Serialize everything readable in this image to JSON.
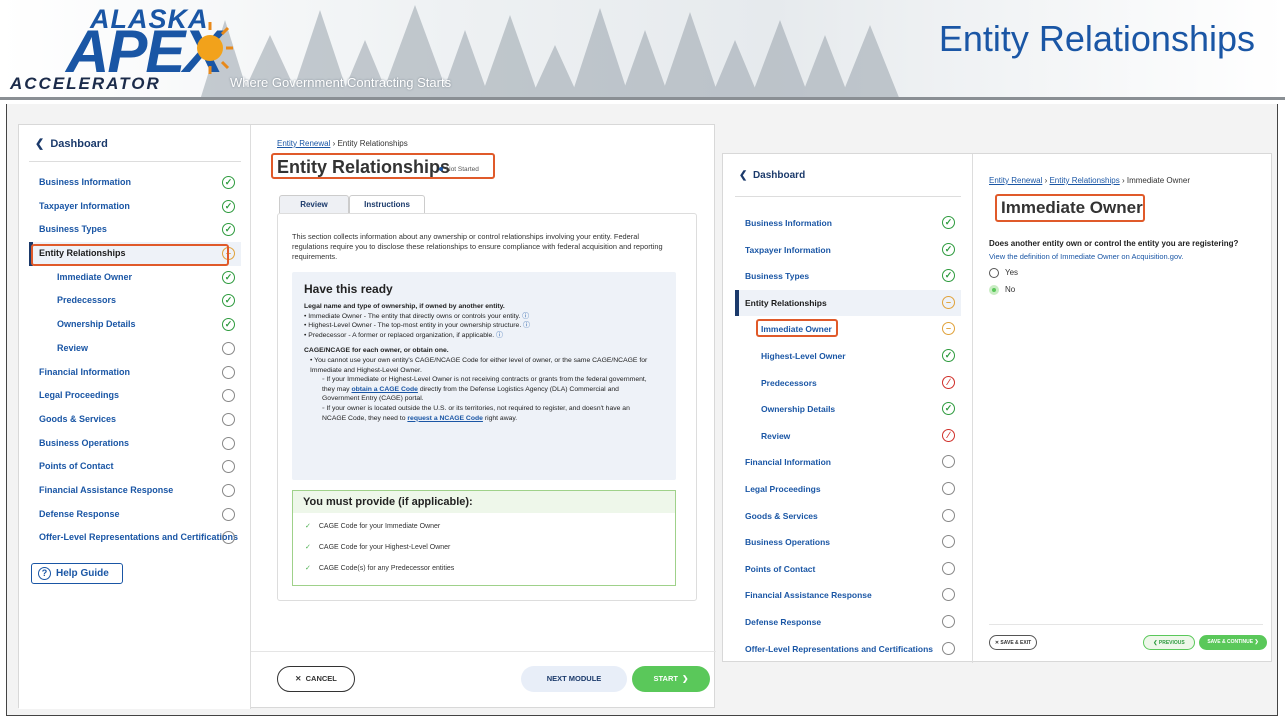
{
  "slide": {
    "logo_top": "ALASKA",
    "logo_main": "APEX",
    "logo_bottom": "ACCELERATOR",
    "tagline": "Where Government Contracting Starts",
    "title": "Entity Relationships"
  },
  "left_screen": {
    "dashboard_label": "Dashboard",
    "nav": [
      {
        "label": "Business Information",
        "status": "ok",
        "sub": false
      },
      {
        "label": "Taxpayer Information",
        "status": "ok",
        "sub": false
      },
      {
        "label": "Business Types",
        "status": "ok",
        "sub": false
      },
      {
        "label": "Entity Relationships",
        "status": "pending",
        "sub": false,
        "active": true
      },
      {
        "label": "Immediate Owner",
        "status": "ok",
        "sub": true
      },
      {
        "label": "Predecessors",
        "status": "ok",
        "sub": true
      },
      {
        "label": "Ownership Details",
        "status": "ok",
        "sub": true
      },
      {
        "label": "Review",
        "status": "empty",
        "sub": true
      },
      {
        "label": "Financial Information",
        "status": "empty",
        "sub": false
      },
      {
        "label": "Legal Proceedings",
        "status": "empty",
        "sub": false
      },
      {
        "label": "Goods & Services",
        "status": "empty",
        "sub": false
      },
      {
        "label": "Business Operations",
        "status": "empty",
        "sub": false
      },
      {
        "label": "Points of Contact",
        "status": "empty",
        "sub": false
      },
      {
        "label": "Financial Assistance Response",
        "status": "empty",
        "sub": false
      },
      {
        "label": "Defense Response",
        "status": "empty",
        "sub": false
      },
      {
        "label": "Offer-Level Representations and Certifications",
        "status": "empty",
        "sub": false
      }
    ],
    "help_label": "Help Guide",
    "breadcrumb_link": "Entity Renewal",
    "breadcrumb_current": "Entity Relationships",
    "heading": "Entity Relationships",
    "status_badge": "Not Started",
    "tabs": [
      "Review",
      "Instructions"
    ],
    "intro": "This section collects information about any ownership or control relationships involving your entity. Federal regulations require you to disclose these relationships to ensure compliance with federal acquisition and reporting requirements.",
    "ready_title": "Have this ready",
    "ready_sub1": "Legal name and type of ownership, if owned by another entity.",
    "ready_items1": [
      "Immediate Owner - The entity that directly owns or controls your entity.",
      "Highest-Level Owner - The top-most entity in your ownership structure.",
      "Predecessor - A former or replaced organization, if applicable."
    ],
    "ready_sub2": "CAGE/NCAGE for each owner, or obtain one.",
    "ready_item2": "You cannot use your own entity's CAGE/NCAGE Code for either level of owner, or the same CAGE/NCAGE for Immediate and Highest-Level Owner.",
    "ready_sub_a1": "If your Immediate or Highest-Level Owner is not receiving contracts or grants from the federal government, they may ",
    "ready_sub_a_link": "obtain a CAGE Code",
    "ready_sub_a2": " directly from the Defense Logistics Agency (DLA) Commercial and Government Entry (CAGE) portal.",
    "ready_sub_b1": "If your owner is located outside the U.S. or its territories, not required to register, and doesn't have an NCAGE Code, they need to ",
    "ready_sub_b_link": "request a NCAGE Code",
    "ready_sub_b2": " right away.",
    "must_title": "You must provide (if applicable):",
    "must_items": [
      "CAGE Code for your Immediate Owner",
      "CAGE Code for your Highest-Level Owner",
      "CAGE Code(s) for any Predecessor entities"
    ],
    "cancel_label": "CANCEL",
    "next_label": "NEXT MODULE",
    "start_label": "START"
  },
  "right_screen": {
    "dashboard_label": "Dashboard",
    "nav": [
      {
        "label": "Business Information",
        "status": "ok",
        "sub": false
      },
      {
        "label": "Taxpayer Information",
        "status": "ok",
        "sub": false
      },
      {
        "label": "Business Types",
        "status": "ok",
        "sub": false
      },
      {
        "label": "Entity Relationships",
        "status": "pending",
        "sub": false,
        "active": true
      },
      {
        "label": "Immediate Owner",
        "status": "pending",
        "sub": true
      },
      {
        "label": "Highest-Level Owner",
        "status": "ok",
        "sub": true
      },
      {
        "label": "Predecessors",
        "status": "error",
        "sub": true
      },
      {
        "label": "Ownership Details",
        "status": "ok",
        "sub": true
      },
      {
        "label": "Review",
        "status": "error",
        "sub": true
      },
      {
        "label": "Financial Information",
        "status": "empty",
        "sub": false
      },
      {
        "label": "Legal Proceedings",
        "status": "empty",
        "sub": false
      },
      {
        "label": "Goods & Services",
        "status": "empty",
        "sub": false
      },
      {
        "label": "Business Operations",
        "status": "empty",
        "sub": false
      },
      {
        "label": "Points of Contact",
        "status": "empty",
        "sub": false
      },
      {
        "label": "Financial Assistance Response",
        "status": "empty",
        "sub": false
      },
      {
        "label": "Defense Response",
        "status": "empty",
        "sub": false
      },
      {
        "label": "Offer-Level Representations and Certifications",
        "status": "empty",
        "sub": false
      }
    ],
    "breadcrumb_1": "Entity Renewal",
    "breadcrumb_2": "Entity Relationships",
    "breadcrumb_current": "Immediate Owner",
    "heading": "Immediate Owner",
    "question": "Does another entity own or control the entity you are registering?",
    "definition_link": "View the definition of Immediate Owner on Acquisition.gov.",
    "option_yes": "Yes",
    "option_no": "No",
    "selected": "No",
    "save_exit": "SAVE & EXIT",
    "previous": "PREVIOUS",
    "save_continue": "SAVE & CONTINUE"
  },
  "colors": {
    "brand": "#1a56a5",
    "ok": "#2e9b3e",
    "pending": "#e0a23a",
    "error": "#d0302a",
    "highlight": "#e05a2a"
  }
}
